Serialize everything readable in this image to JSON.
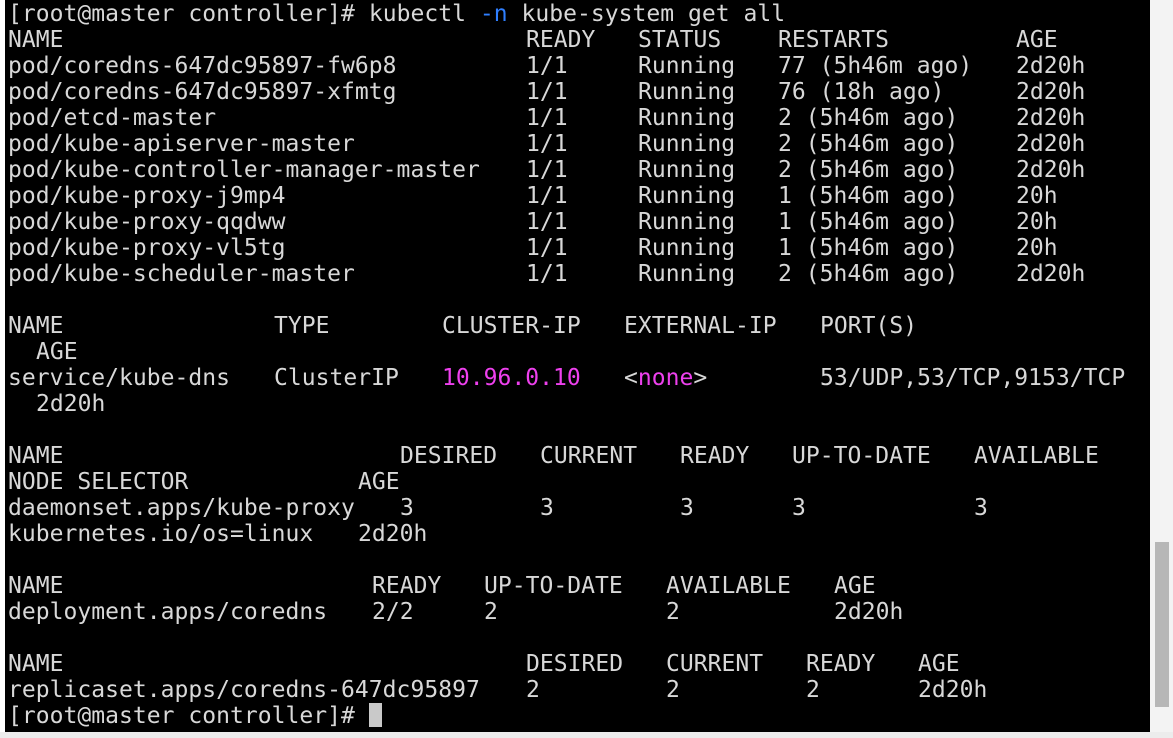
{
  "prompt": "[root@master controller]# ",
  "command": {
    "cmd": "kubectl ",
    "flag": "-n",
    "rest": " kube-system get all"
  },
  "pods": {
    "headers": [
      "NAME",
      "READY",
      "STATUS",
      "RESTARTS",
      "AGE"
    ],
    "rows": [
      [
        "pod/coredns-647dc95897-fw6p8",
        "1/1",
        "Running",
        "77 (5h46m ago)",
        "2d20h"
      ],
      [
        "pod/coredns-647dc95897-xfmtg",
        "1/1",
        "Running",
        "76 (18h ago)",
        "2d20h"
      ],
      [
        "pod/etcd-master",
        "1/1",
        "Running",
        "2 (5h46m ago)",
        "2d20h"
      ],
      [
        "pod/kube-apiserver-master",
        "1/1",
        "Running",
        "2 (5h46m ago)",
        "2d20h"
      ],
      [
        "pod/kube-controller-manager-master",
        "1/1",
        "Running",
        "2 (5h46m ago)",
        "2d20h"
      ],
      [
        "pod/kube-proxy-j9mp4",
        "1/1",
        "Running",
        "1 (5h46m ago)",
        "20h"
      ],
      [
        "pod/kube-proxy-qqdww",
        "1/1",
        "Running",
        "1 (5h46m ago)",
        "20h"
      ],
      [
        "pod/kube-proxy-vl5tg",
        "1/1",
        "Running",
        "1 (5h46m ago)",
        "20h"
      ],
      [
        "pod/kube-scheduler-master",
        "1/1",
        "Running",
        "2 (5h46m ago)",
        "2d20h"
      ]
    ]
  },
  "services": {
    "headers": [
      "NAME",
      "TYPE",
      "CLUSTER-IP",
      "EXTERNAL-IP",
      "PORT(S)",
      "AGE"
    ],
    "row": {
      "name": "service/kube-dns",
      "type": "ClusterIP",
      "cluster_ip": "10.96.0.10",
      "external_ip_open": "<",
      "external_ip_value": "none",
      "external_ip_close": ">",
      "ports": "53/UDP,53/TCP,9153/TCP",
      "age": "2d20h"
    }
  },
  "daemonsets": {
    "headers": [
      "NAME",
      "DESIRED",
      "CURRENT",
      "READY",
      "UP-TO-DATE",
      "AVAILABLE",
      "NODE SELECTOR",
      "AGE"
    ],
    "row": {
      "name": "daemonset.apps/kube-proxy",
      "desired": "3",
      "current": "3",
      "ready": "3",
      "up_to_date": "3",
      "available": "3",
      "node_selector": "kubernetes.io/os=linux",
      "age": "2d20h"
    }
  },
  "deployments": {
    "headers": [
      "NAME",
      "READY",
      "UP-TO-DATE",
      "AVAILABLE",
      "AGE"
    ],
    "row": [
      "deployment.apps/coredns",
      "2/2",
      "2",
      "2",
      "2d20h"
    ]
  },
  "replicasets": {
    "headers": [
      "NAME",
      "DESIRED",
      "CURRENT",
      "READY",
      "AGE"
    ],
    "row": [
      "replicaset.apps/coredns-647dc95897",
      "2",
      "2",
      "2",
      "2d20h"
    ]
  },
  "colors": {
    "background": "#000000",
    "foreground": "#d8d8d8",
    "highlight_magenta": "#ee40ee",
    "flag_blue": "#2f7fff"
  }
}
